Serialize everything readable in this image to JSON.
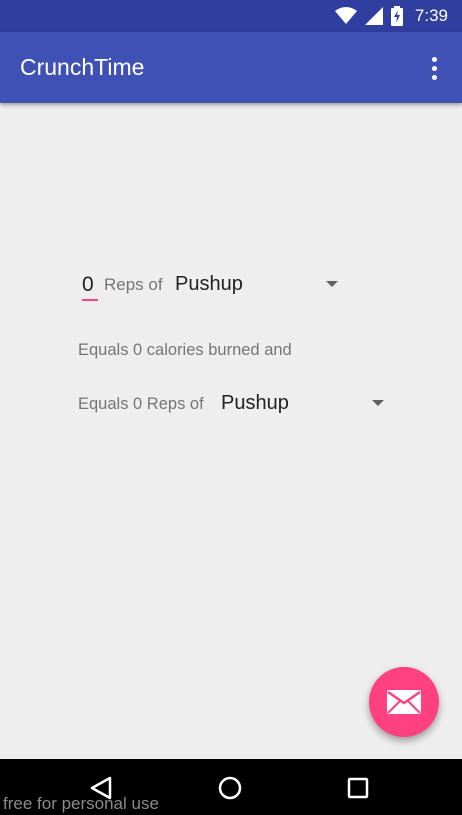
{
  "status_bar": {
    "time": "7:39",
    "icons": [
      "wifi-icon",
      "cell-signal-icon",
      "battery-charging-icon"
    ]
  },
  "app_bar": {
    "title": "CrunchTime",
    "overflow_icon": "more-vert-icon"
  },
  "form": {
    "reps_value": "0",
    "reps_of_label": "Reps of",
    "exercise_1": "Pushup",
    "equals_calories": "Equals 0 calories burned and",
    "equals_reps": "Equals 0 Reps of",
    "exercise_2": "Pushup"
  },
  "fab": {
    "icon": "email-icon"
  },
  "nav_bar": {
    "icons": [
      "back-icon",
      "home-icon",
      "recents-icon"
    ]
  },
  "watermark": "free for personal use",
  "colors": {
    "primary": "#3f51b5",
    "primary_dark": "#303f9f",
    "accent": "#ff4081",
    "background": "#eeeeee"
  }
}
